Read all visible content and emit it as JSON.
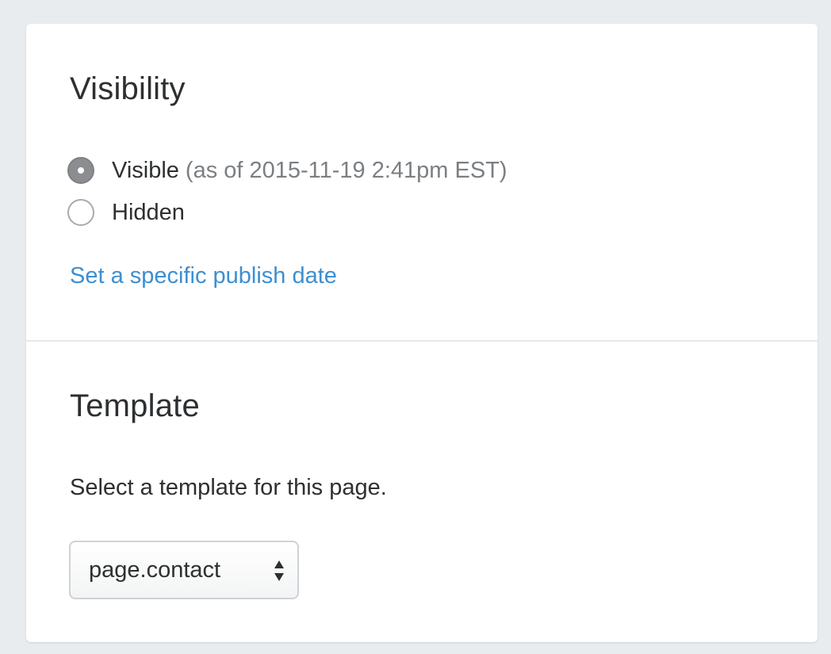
{
  "visibility": {
    "title": "Visibility",
    "options": [
      {
        "label": "Visible",
        "note": "(as of 2015-11-19 2:41pm EST)",
        "checked": true
      },
      {
        "label": "Hidden",
        "checked": false
      }
    ],
    "publish_link": "Set a specific publish date"
  },
  "template": {
    "title": "Template",
    "description": "Select a template for this page.",
    "selected": "page.contact",
    "icon": "select-arrows-icon"
  },
  "colors": {
    "link": "#3d8fd1",
    "background": "#e9ecef",
    "card": "#ffffff",
    "muted_text": "#7b7f83"
  }
}
